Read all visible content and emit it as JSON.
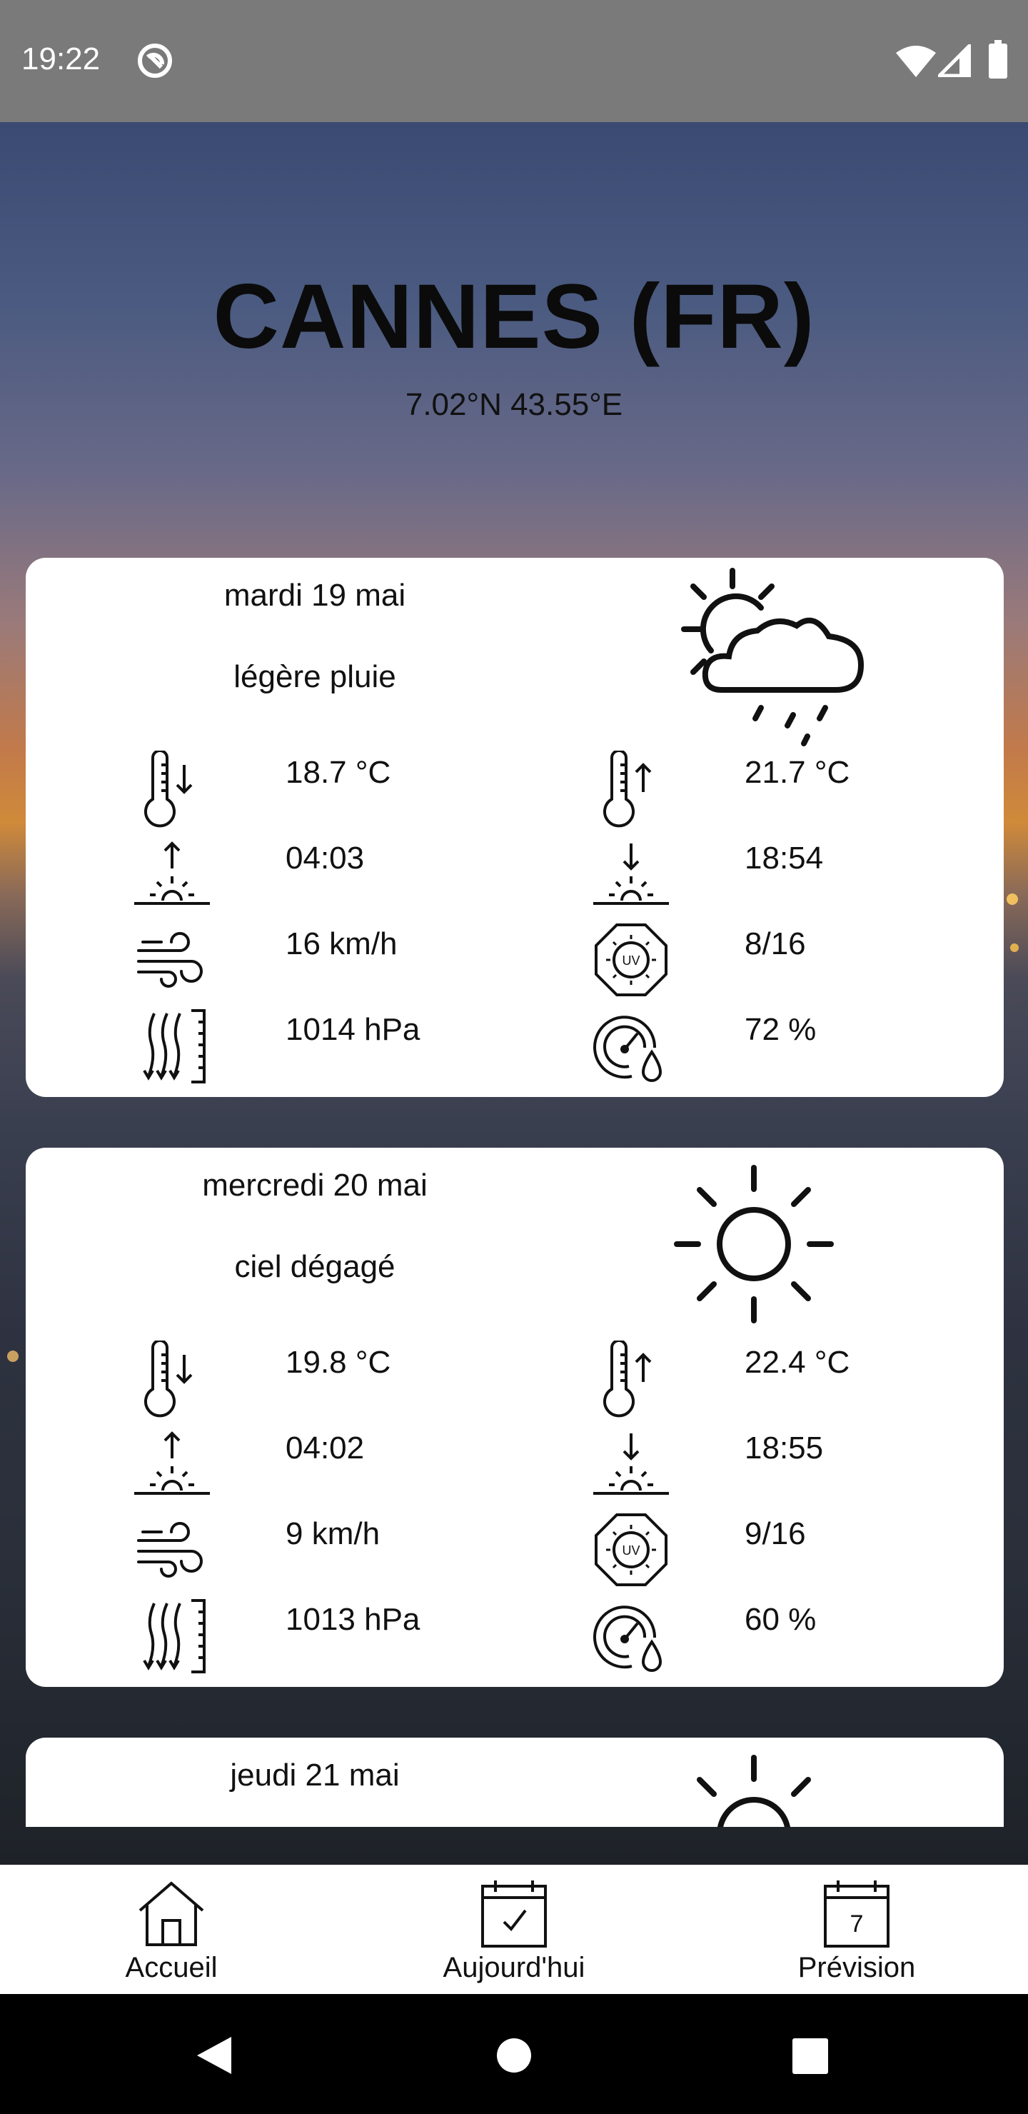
{
  "status_bar": {
    "time": "19:22",
    "icons": [
      "no-disturb-icon",
      "wifi-icon",
      "signal-icon",
      "battery-icon"
    ]
  },
  "city": {
    "title": "CANNES (FR)",
    "coords": "7.02°N 43.55°E"
  },
  "days": [
    {
      "date": "mardi 19 mai",
      "description": "légère pluie",
      "weather_icon": "partly-cloudy-rain-icon",
      "temp_min": "18.7 °C",
      "temp_max": "21.7 °C",
      "sunrise": "04:03",
      "sunset": "18:54",
      "wind": "16 km/h",
      "uv": "8/16",
      "pressure": "1014 hPa",
      "humidity": "72 %"
    },
    {
      "date": "mercredi 20 mai",
      "description": "ciel dégagé",
      "weather_icon": "sun-icon",
      "temp_min": "19.8 °C",
      "temp_max": "22.4 °C",
      "sunrise": "04:02",
      "sunset": "18:55",
      "wind": "9 km/h",
      "uv": "9/16",
      "pressure": "1013 hPa",
      "humidity": "60 %"
    },
    {
      "date": "jeudi 21 mai",
      "weather_icon": "sun-icon"
    }
  ],
  "bottom_nav": {
    "items": [
      {
        "label": "Accueil",
        "icon": "home-icon"
      },
      {
        "label": "Aujourd'hui",
        "icon": "calendar-check-icon"
      },
      {
        "label": "Prévision",
        "icon": "calendar-7-icon",
        "badge": "7"
      }
    ]
  },
  "system_nav": [
    "back-icon",
    "home-circle-icon",
    "recents-icon"
  ]
}
